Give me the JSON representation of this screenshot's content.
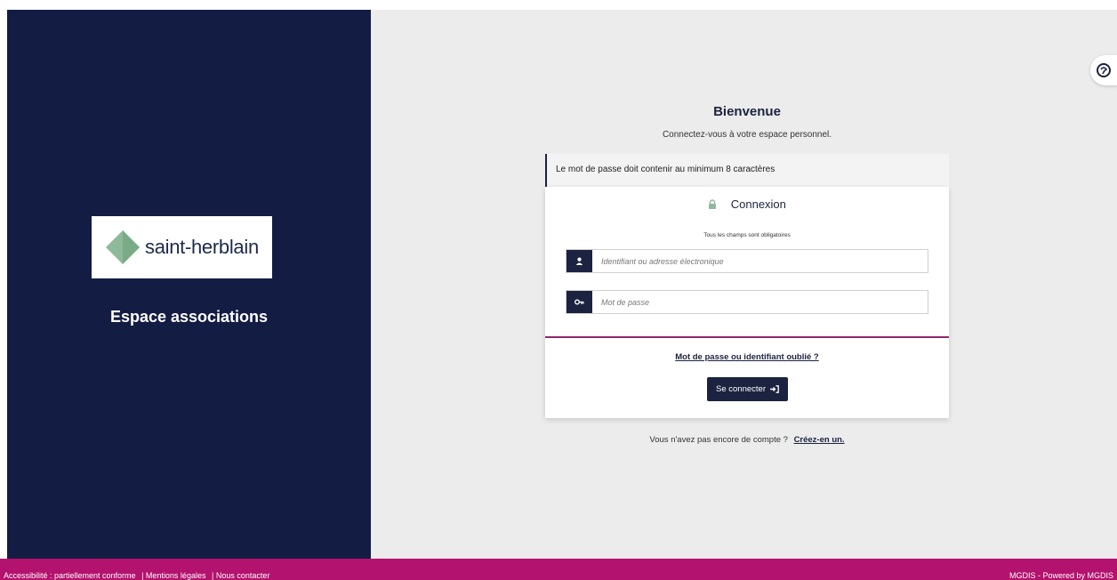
{
  "brand": {
    "logo_text": "saint-herblain",
    "section_title": "Espace associations",
    "colors": {
      "navy": "#131d43",
      "accent": "#b3126e",
      "diamond": "#8fb99b"
    }
  },
  "login": {
    "title": "Bienvenue",
    "subtitle": "Connectez-vous à votre espace personnel.",
    "notice": "Le mot de passe doit contenir au minimum 8 caractères",
    "card_title": "Connexion",
    "card_icon": "lock-icon",
    "required_note": "Tous les champs sont obligatoires",
    "username": {
      "placeholder": "Identifiant ou adresse électronique",
      "value": "",
      "icon": "user-icon"
    },
    "password": {
      "placeholder": "Mot de passe",
      "value": "",
      "icon": "key-icon"
    },
    "forgot_label": "Mot de passe ou identifiant oublié ?",
    "submit_label": "Se connecter",
    "submit_icon": "sign-in-icon",
    "signup_prompt": "Vous n'avez pas encore de compte ?",
    "signup_label": "Créez-en un."
  },
  "help": {
    "icon": "help-bubble-icon"
  },
  "footer": {
    "links": [
      "Accessibilité : partiellement conforme",
      "| Mentions légales",
      "| Nous contacter"
    ],
    "credit": "MGDIS - Powered by MGDIS"
  }
}
